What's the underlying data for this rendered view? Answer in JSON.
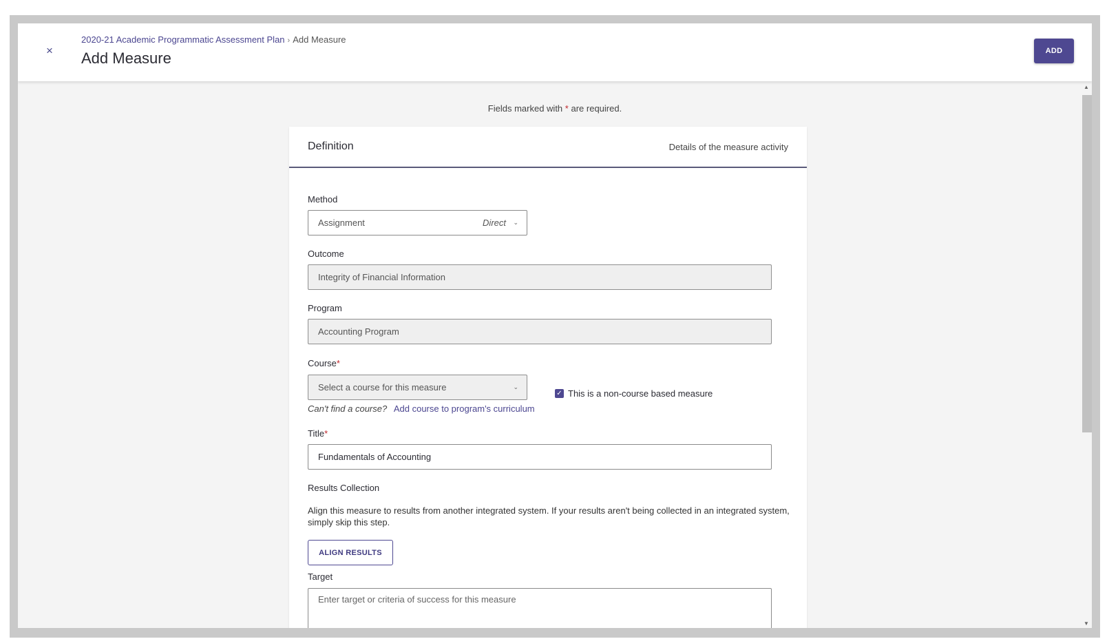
{
  "header": {
    "breadcrumb_parent": "2020-21 Academic Programmatic Assessment Plan",
    "breadcrumb_separator": "›",
    "breadcrumb_current": "Add Measure",
    "title": "Add Measure",
    "close_label": "×",
    "add_label": "ADD"
  },
  "form": {
    "required_prefix": "Fields marked with",
    "required_star": "*",
    "required_suffix": "are required.",
    "section_title": "Definition",
    "section_subtitle": "Details of the measure activity",
    "method": {
      "label": "Method",
      "value": "Assignment",
      "tag": "Direct"
    },
    "outcome": {
      "label": "Outcome",
      "value": "Integrity of Financial Information"
    },
    "program": {
      "label": "Program",
      "value": "Accounting Program"
    },
    "course": {
      "label": "Course",
      "required_star": "*",
      "placeholder": "Select a course for this measure",
      "checkbox_label": "This is a non-course based measure",
      "checkbox_checked": true,
      "help_question": "Can't find a course?",
      "help_link": "Add course to program's curriculum"
    },
    "title": {
      "label": "Title",
      "required_star": "*",
      "value": "Fundamentals of Accounting"
    },
    "results": {
      "label": "Results Collection",
      "description": "Align this measure to results from another integrated system. If your results aren't being collected in an integrated system, simply skip this step.",
      "button_label": "ALIGN RESULTS"
    },
    "target": {
      "label": "Target",
      "placeholder": "Enter target or criteria of success for this measure"
    }
  },
  "colors": {
    "accent": "#4e4891",
    "required": "#c0282d"
  }
}
